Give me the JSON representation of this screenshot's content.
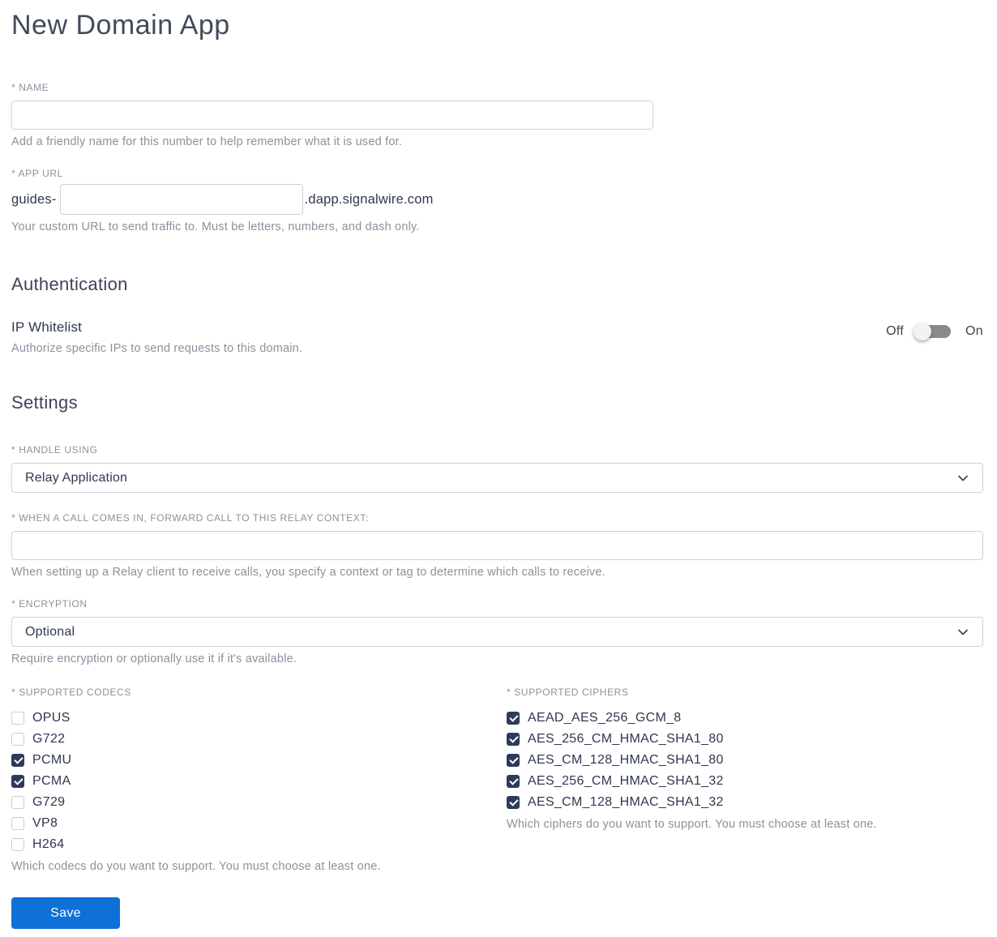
{
  "page": {
    "title": "New Domain App"
  },
  "name_field": {
    "label": "* NAME",
    "value": "",
    "help": "Add a friendly name for this number to help remember what it is used for."
  },
  "app_url_field": {
    "label": "* APP URL",
    "prefix": "guides-",
    "value": "",
    "suffix": ".dapp.signalwire.com",
    "help": "Your custom URL to send traffic to. Must be letters, numbers, and dash only."
  },
  "authentication": {
    "heading": "Authentication",
    "ip_whitelist": {
      "label": "IP Whitelist",
      "help": "Authorize specific IPs to send requests to this domain.",
      "toggle": {
        "off_label": "Off",
        "on_label": "On",
        "state": "off"
      }
    }
  },
  "settings": {
    "heading": "Settings",
    "handle_using": {
      "label": "* HANDLE USING",
      "value": "Relay Application"
    },
    "relay_context": {
      "label": "* WHEN A CALL COMES IN, FORWARD CALL TO THIS RELAY CONTEXT:",
      "value": "",
      "help": "When setting up a Relay client to receive calls, you specify a context or tag to determine which calls to receive."
    },
    "encryption": {
      "label": "* ENCRYPTION",
      "value": "Optional",
      "help": "Require encryption or optionally use it if it's available."
    },
    "codecs": {
      "label": "* SUPPORTED CODECS",
      "help": "Which codecs do you want to support. You must choose at least one.",
      "options": [
        {
          "label": "OPUS",
          "checked": false
        },
        {
          "label": "G722",
          "checked": false
        },
        {
          "label": "PCMU",
          "checked": true
        },
        {
          "label": "PCMA",
          "checked": true
        },
        {
          "label": "G729",
          "checked": false
        },
        {
          "label": "VP8",
          "checked": false
        },
        {
          "label": "H264",
          "checked": false
        }
      ]
    },
    "ciphers": {
      "label": "* SUPPORTED CIPHERS",
      "help": "Which ciphers do you want to support. You must choose at least one.",
      "options": [
        {
          "label": "AEAD_AES_256_GCM_8",
          "checked": true
        },
        {
          "label": "AES_256_CM_HMAC_SHA1_80",
          "checked": true
        },
        {
          "label": "AES_CM_128_HMAC_SHA1_80",
          "checked": true
        },
        {
          "label": "AES_256_CM_HMAC_SHA1_32",
          "checked": true
        },
        {
          "label": "AES_CM_128_HMAC_SHA1_32",
          "checked": true
        }
      ]
    }
  },
  "actions": {
    "save_label": "Save"
  },
  "colors": {
    "primary_blue": "#0e71d8",
    "checkbox_checked": "#2e3a59",
    "text_dark": "#2e3850",
    "text_muted": "#8b919d",
    "toggle_track": "#8a8a8a"
  }
}
